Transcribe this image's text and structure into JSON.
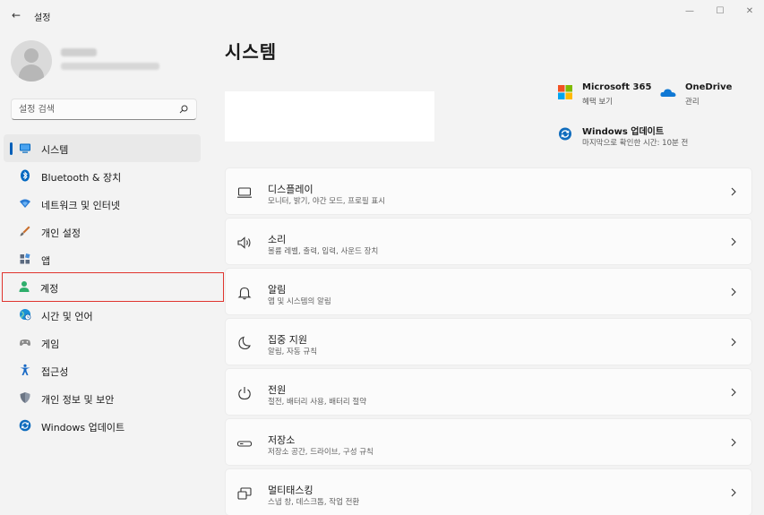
{
  "window": {
    "back_glyph": "←",
    "title": "설정",
    "minimize_glyph": "—",
    "maximize_glyph": "☐",
    "close_glyph": "✕"
  },
  "search": {
    "placeholder": "설정 검색"
  },
  "sidebar": {
    "items": [
      {
        "label": "시스템",
        "icon": "monitor-icon",
        "color": "#0067c0"
      },
      {
        "label": "Bluetooth & 장치",
        "icon": "bluetooth-icon",
        "color": "#0067c0"
      },
      {
        "label": "네트워크 및 인터넷",
        "icon": "wifi-icon",
        "color": "#2a7bd4"
      },
      {
        "label": "개인 설정",
        "icon": "brush-icon",
        "color": "#c96f2d"
      },
      {
        "label": "앱",
        "icon": "apps-icon",
        "color": "#5b6a80"
      },
      {
        "label": "계정",
        "icon": "person-icon",
        "color": "#2eae6b"
      },
      {
        "label": "시간 및 언어",
        "icon": "globe-clock-icon",
        "color": "#1a8fd6"
      },
      {
        "label": "게임",
        "icon": "gamepad-icon",
        "color": "#7a7a7a"
      },
      {
        "label": "접근성",
        "icon": "accessibility-icon",
        "color": "#1768c4"
      },
      {
        "label": "개인 정보 및 보안",
        "icon": "shield-icon",
        "color": "#6b7584"
      },
      {
        "label": "Windows 업데이트",
        "icon": "update-icon",
        "color": "#0f6cbd"
      }
    ]
  },
  "main": {
    "title": "시스템",
    "quick_links": {
      "microsoft365": {
        "title": "Microsoft 365",
        "sub": "혜택 보기"
      },
      "onedrive": {
        "title": "OneDrive",
        "sub": "관리"
      },
      "windows_update": {
        "title": "Windows 업데이트",
        "sub": "마지막으로 확인한 시간: 10분 전"
      }
    },
    "cards": [
      {
        "title": "디스플레이",
        "sub": "모니터, 밝기, 야간 모드, 프로필 표시",
        "icon": "display-icon"
      },
      {
        "title": "소리",
        "sub": "볼륨 레벨, 출력, 입력, 사운드 장치",
        "icon": "speaker-icon"
      },
      {
        "title": "알림",
        "sub": "앱 및 시스템의 알림",
        "icon": "bell-icon"
      },
      {
        "title": "집중 지원",
        "sub": "알림, 자동 규칙",
        "icon": "moon-icon"
      },
      {
        "title": "전원",
        "sub": "절전, 배터리 사용, 배터리 절약",
        "icon": "power-icon"
      },
      {
        "title": "저장소",
        "sub": "저장소 공간, 드라이브, 구성 규칙",
        "icon": "storage-icon"
      },
      {
        "title": "멀티태스킹",
        "sub": "스냅 창, 데스크톱, 작업 전환",
        "icon": "multitasking-icon"
      }
    ]
  },
  "colors": {
    "accent": "#005fb8",
    "highlight_outline": "#e0342e"
  }
}
